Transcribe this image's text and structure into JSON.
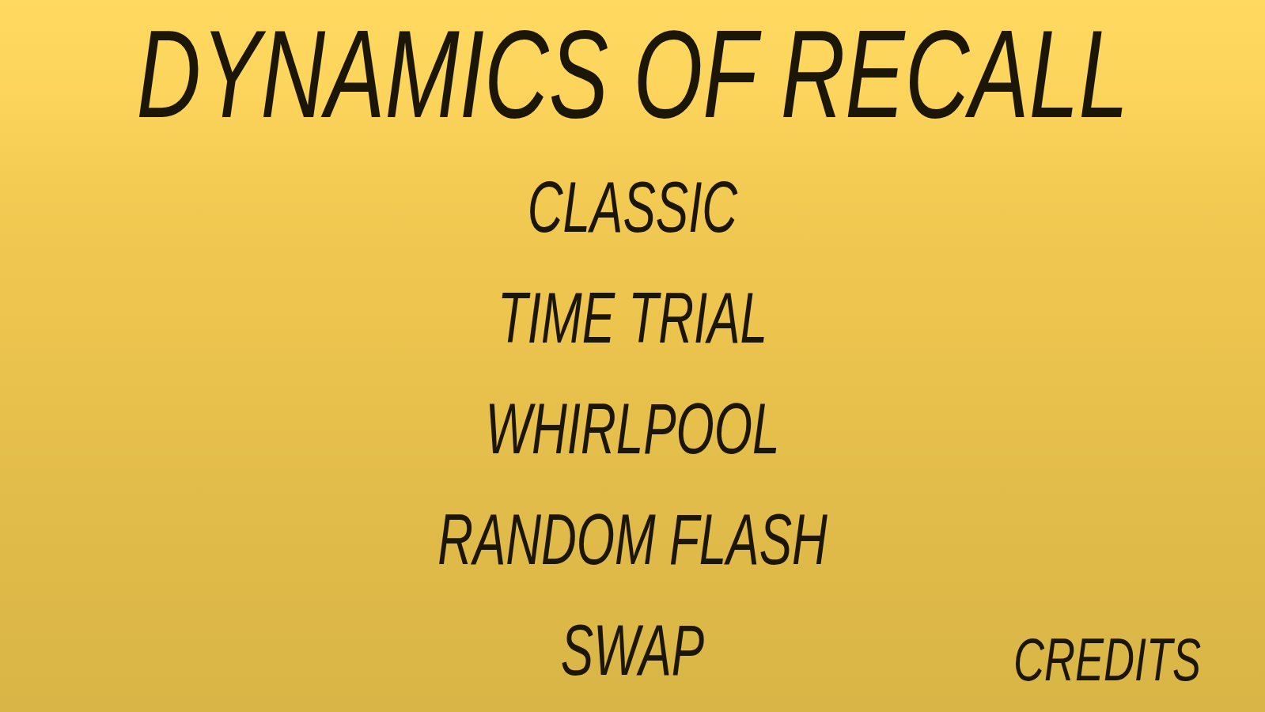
{
  "title": "DYNAMICS OF RECALL",
  "menu": [
    "CLASSIC",
    "TIME TRIAL",
    "WHIRLPOOL",
    "RANDOM FLASH",
    "SWAP"
  ],
  "credits": "CREDITS"
}
